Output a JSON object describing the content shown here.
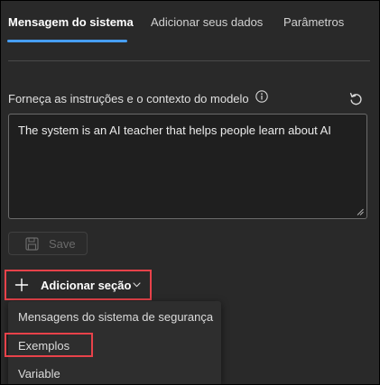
{
  "tabs": [
    {
      "label": "Mensagem do sistema",
      "active": true
    },
    {
      "label": "Adicionar seus dados",
      "active": false
    },
    {
      "label": "Parâmetros",
      "active": false
    }
  ],
  "instructions": {
    "label": "Forneça as instruções e o contexto do modelo",
    "info_icon": "info-icon",
    "reset_icon": "reset-icon",
    "value": "The system is an AI teacher that helps people learn about AI"
  },
  "save_button": {
    "label": "Save",
    "icon": "save-icon",
    "enabled": false
  },
  "add_section": {
    "label": "Adicionar seção",
    "icon": "plus-icon",
    "chevron": "chevron-down-icon"
  },
  "menu": {
    "items": [
      {
        "label": "Mensagens do sistema de segurança"
      },
      {
        "label": "Exemplos"
      },
      {
        "label": "Variable"
      }
    ]
  },
  "colors": {
    "background": "#292929",
    "accent": "#479ef5",
    "highlight": "#e8424a",
    "menu_background": "#2e2e2e"
  }
}
